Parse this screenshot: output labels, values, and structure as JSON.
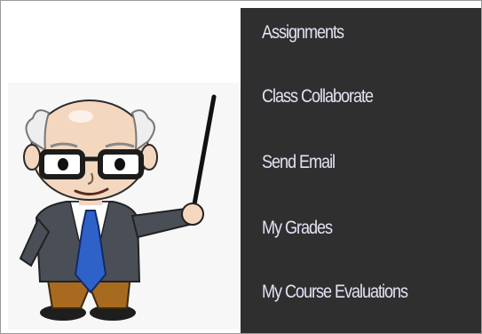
{
  "menu": {
    "items": [
      {
        "label": "Assignments"
      },
      {
        "label": "Class Collaborate"
      },
      {
        "label": "Send Email"
      },
      {
        "label": "My Grades"
      },
      {
        "label": "My Course Evaluations"
      }
    ]
  },
  "illustration": {
    "icon": "teacher-with-pointer-icon"
  },
  "colors": {
    "menu_background": "#2f2f2f",
    "menu_text": "#e6e1f4",
    "tie": "#2f62c8",
    "suit": "#4a4f57",
    "pants": "#a86a1e"
  }
}
